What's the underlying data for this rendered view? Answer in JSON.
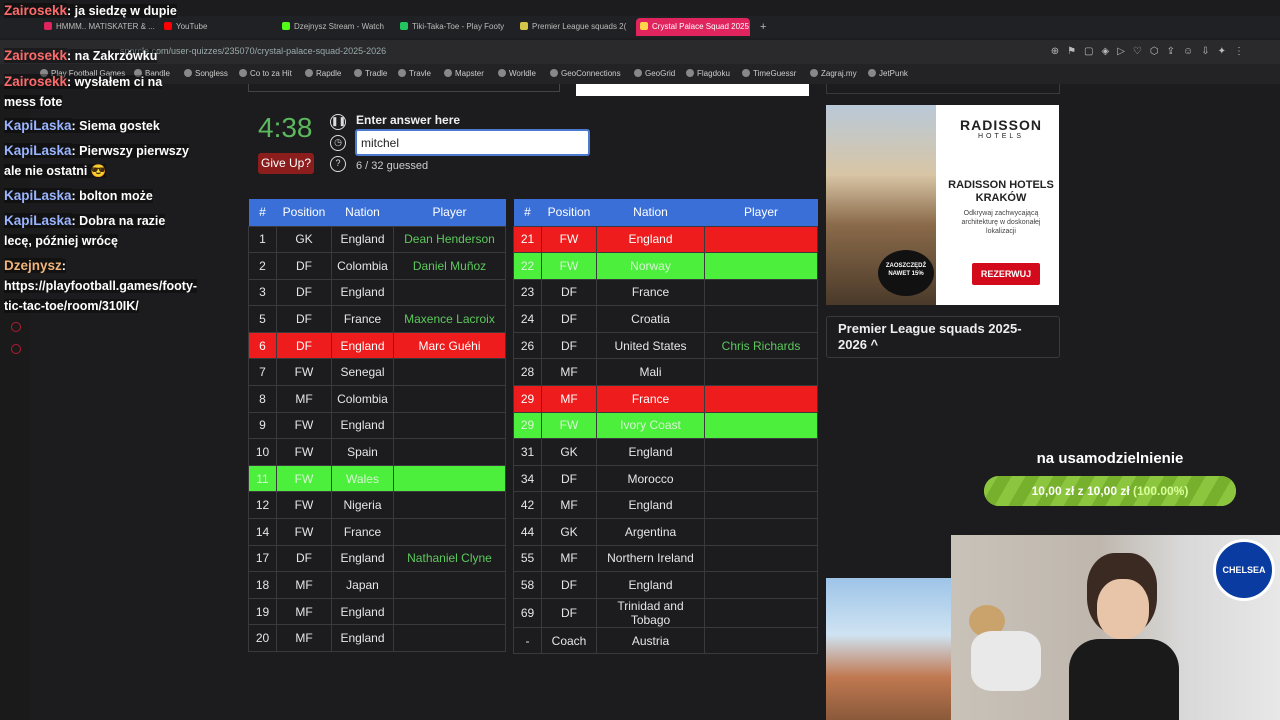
{
  "browser": {
    "tabs": [
      {
        "label": "HMMM.. MATISKATER & ...",
        "color": "#e0245e",
        "active": false
      },
      {
        "label": "YouTube",
        "color": "#ff0000",
        "active": false
      },
      {
        "label": "Dzejnysz Stream - Watch",
        "color": "#53fc18",
        "active": false
      },
      {
        "label": "Tiki-Taka-Toe - Play Footy",
        "color": "#22c55e",
        "active": false
      },
      {
        "label": "Premier League squads 2(",
        "color": "#d4c44a",
        "active": false
      },
      {
        "label": "Crystal Palace Squad 2025",
        "color": "#ffd54a",
        "active": true
      }
    ],
    "url": "sporcle.com/user-quizzes/235070/crystal-palace-squad-2025-2026",
    "bookmarks": [
      "Play Football Games",
      "Bandle",
      "Songless",
      "Co to za Hit",
      "Rapdle",
      "Tradle",
      "Travle",
      "Mapster",
      "Worldle",
      "GeoConnections",
      "GeoGrid",
      "Flagdoku",
      "TimeGuessr",
      "Zagraj.my",
      "JetPunk"
    ],
    "toolbar_icons": [
      "zoom-icon",
      "pin-icon",
      "screenshot-icon",
      "shield-icon",
      "play-icon",
      "heart-icon",
      "extensions-icon",
      "share-icon",
      "account-icon",
      "download-icon",
      "ai-icon",
      "settings-icon"
    ]
  },
  "quiz": {
    "timer": "4:38",
    "give_up_label": "Give Up?",
    "enter_label": "Enter answer here",
    "answer_value": "mitchel",
    "guessed": "6 / 32 guessed",
    "columns": [
      "#",
      "Position",
      "Nation",
      "Player"
    ],
    "left_rows": [
      {
        "num": "1",
        "pos": "GK",
        "nation": "England",
        "player": "Dean Henderson",
        "state": ""
      },
      {
        "num": "2",
        "pos": "DF",
        "nation": "Colombia",
        "player": "Daniel Muñoz",
        "state": ""
      },
      {
        "num": "3",
        "pos": "DF",
        "nation": "England",
        "player": "",
        "state": ""
      },
      {
        "num": "5",
        "pos": "DF",
        "nation": "France",
        "player": "Maxence Lacroix",
        "state": ""
      },
      {
        "num": "6",
        "pos": "DF",
        "nation": "England",
        "player": "Marc Guéhi",
        "state": "red"
      },
      {
        "num": "7",
        "pos": "FW",
        "nation": "Senegal",
        "player": "",
        "state": ""
      },
      {
        "num": "8",
        "pos": "MF",
        "nation": "Colombia",
        "player": "",
        "state": ""
      },
      {
        "num": "9",
        "pos": "FW",
        "nation": "England",
        "player": "",
        "state": ""
      },
      {
        "num": "10",
        "pos": "FW",
        "nation": "Spain",
        "player": "",
        "state": ""
      },
      {
        "num": "11",
        "pos": "FW",
        "nation": "Wales",
        "player": "",
        "state": "green"
      },
      {
        "num": "12",
        "pos": "FW",
        "nation": "Nigeria",
        "player": "",
        "state": ""
      },
      {
        "num": "14",
        "pos": "FW",
        "nation": "France",
        "player": "",
        "state": ""
      },
      {
        "num": "17",
        "pos": "DF",
        "nation": "England",
        "player": "Nathaniel Clyne",
        "state": ""
      },
      {
        "num": "18",
        "pos": "MF",
        "nation": "Japan",
        "player": "",
        "state": ""
      },
      {
        "num": "19",
        "pos": "MF",
        "nation": "England",
        "player": "",
        "state": ""
      },
      {
        "num": "20",
        "pos": "MF",
        "nation": "England",
        "player": "",
        "state": ""
      }
    ],
    "right_rows": [
      {
        "num": "21",
        "pos": "FW",
        "nation": "England",
        "player": "",
        "state": "red"
      },
      {
        "num": "22",
        "pos": "FW",
        "nation": "Norway",
        "player": "",
        "state": "green"
      },
      {
        "num": "23",
        "pos": "DF",
        "nation": "France",
        "player": "",
        "state": ""
      },
      {
        "num": "24",
        "pos": "DF",
        "nation": "Croatia",
        "player": "",
        "state": ""
      },
      {
        "num": "26",
        "pos": "DF",
        "nation": "United States",
        "player": "Chris Richards",
        "state": ""
      },
      {
        "num": "28",
        "pos": "MF",
        "nation": "Mali",
        "player": "",
        "state": ""
      },
      {
        "num": "29",
        "pos": "MF",
        "nation": "France",
        "player": "",
        "state": "red"
      },
      {
        "num": "29",
        "pos": "FW",
        "nation": "Ivory Coast",
        "player": "",
        "state": "green"
      },
      {
        "num": "31",
        "pos": "GK",
        "nation": "England",
        "player": "",
        "state": ""
      },
      {
        "num": "34",
        "pos": "DF",
        "nation": "Morocco",
        "player": "",
        "state": ""
      },
      {
        "num": "42",
        "pos": "MF",
        "nation": "England",
        "player": "",
        "state": ""
      },
      {
        "num": "44",
        "pos": "GK",
        "nation": "Argentina",
        "player": "",
        "state": ""
      },
      {
        "num": "55",
        "pos": "MF",
        "nation": "Northern Ireland",
        "player": "",
        "state": ""
      },
      {
        "num": "58",
        "pos": "DF",
        "nation": "England",
        "player": "",
        "state": ""
      },
      {
        "num": "69",
        "pos": "DF",
        "nation": "Trinidad and Tobago",
        "player": "",
        "state": ""
      },
      {
        "num": "-",
        "pos": "Coach",
        "nation": "Austria",
        "player": "",
        "state": ""
      }
    ]
  },
  "ads": {
    "radisson_brand": "RADISSON",
    "radisson_sub": "HOTELS",
    "radisson_headline": "RADISSON HOTELS KRAKÓW",
    "radisson_text": "Odkrywaj zachwycającą architekturę w doskonałej lokalizacji",
    "radisson_cta": "REZERWUJ",
    "radisson_badge": "ZAOSZCZĘDŹ NAWET 15%"
  },
  "sidebar_box": {
    "title": "Premier League squads 2025-2026",
    "chevron": "^"
  },
  "chat": [
    {
      "user": "Zairosekk",
      "text": ": ja siedzę w dupie",
      "color": "z"
    },
    {
      "user": "Zairosekk",
      "text": ": na Zakrzówku",
      "color": "z"
    },
    {
      "user": "Zairosekk",
      "text": ": wysłałem ci na mess fote",
      "color": "z"
    },
    {
      "user": "KapiLaska",
      "text": ": Siema gostek",
      "color": "k"
    },
    {
      "user": "KapiLaska",
      "text": ": Pierwszy pierwszy ale nie ostatni 😎",
      "color": "k"
    },
    {
      "user": "KapiLaska",
      "text": ": bolton może",
      "color": "k"
    },
    {
      "user": "KapiLaska",
      "text": ": Dobra na razie lecę, później wrócę",
      "color": "k"
    },
    {
      "user": "Dzejnysz",
      "text": ": https://playfootball.games/footy-tic-tac-toe/room/310IK/",
      "color": "d"
    }
  ],
  "donation": {
    "title": "na usamodzielnienie",
    "amount": "10,00 zł z 10,00 zł",
    "percent": "(100.00%)",
    "progress": 1.0
  },
  "webcam": {
    "badge": "CHELSEA"
  }
}
